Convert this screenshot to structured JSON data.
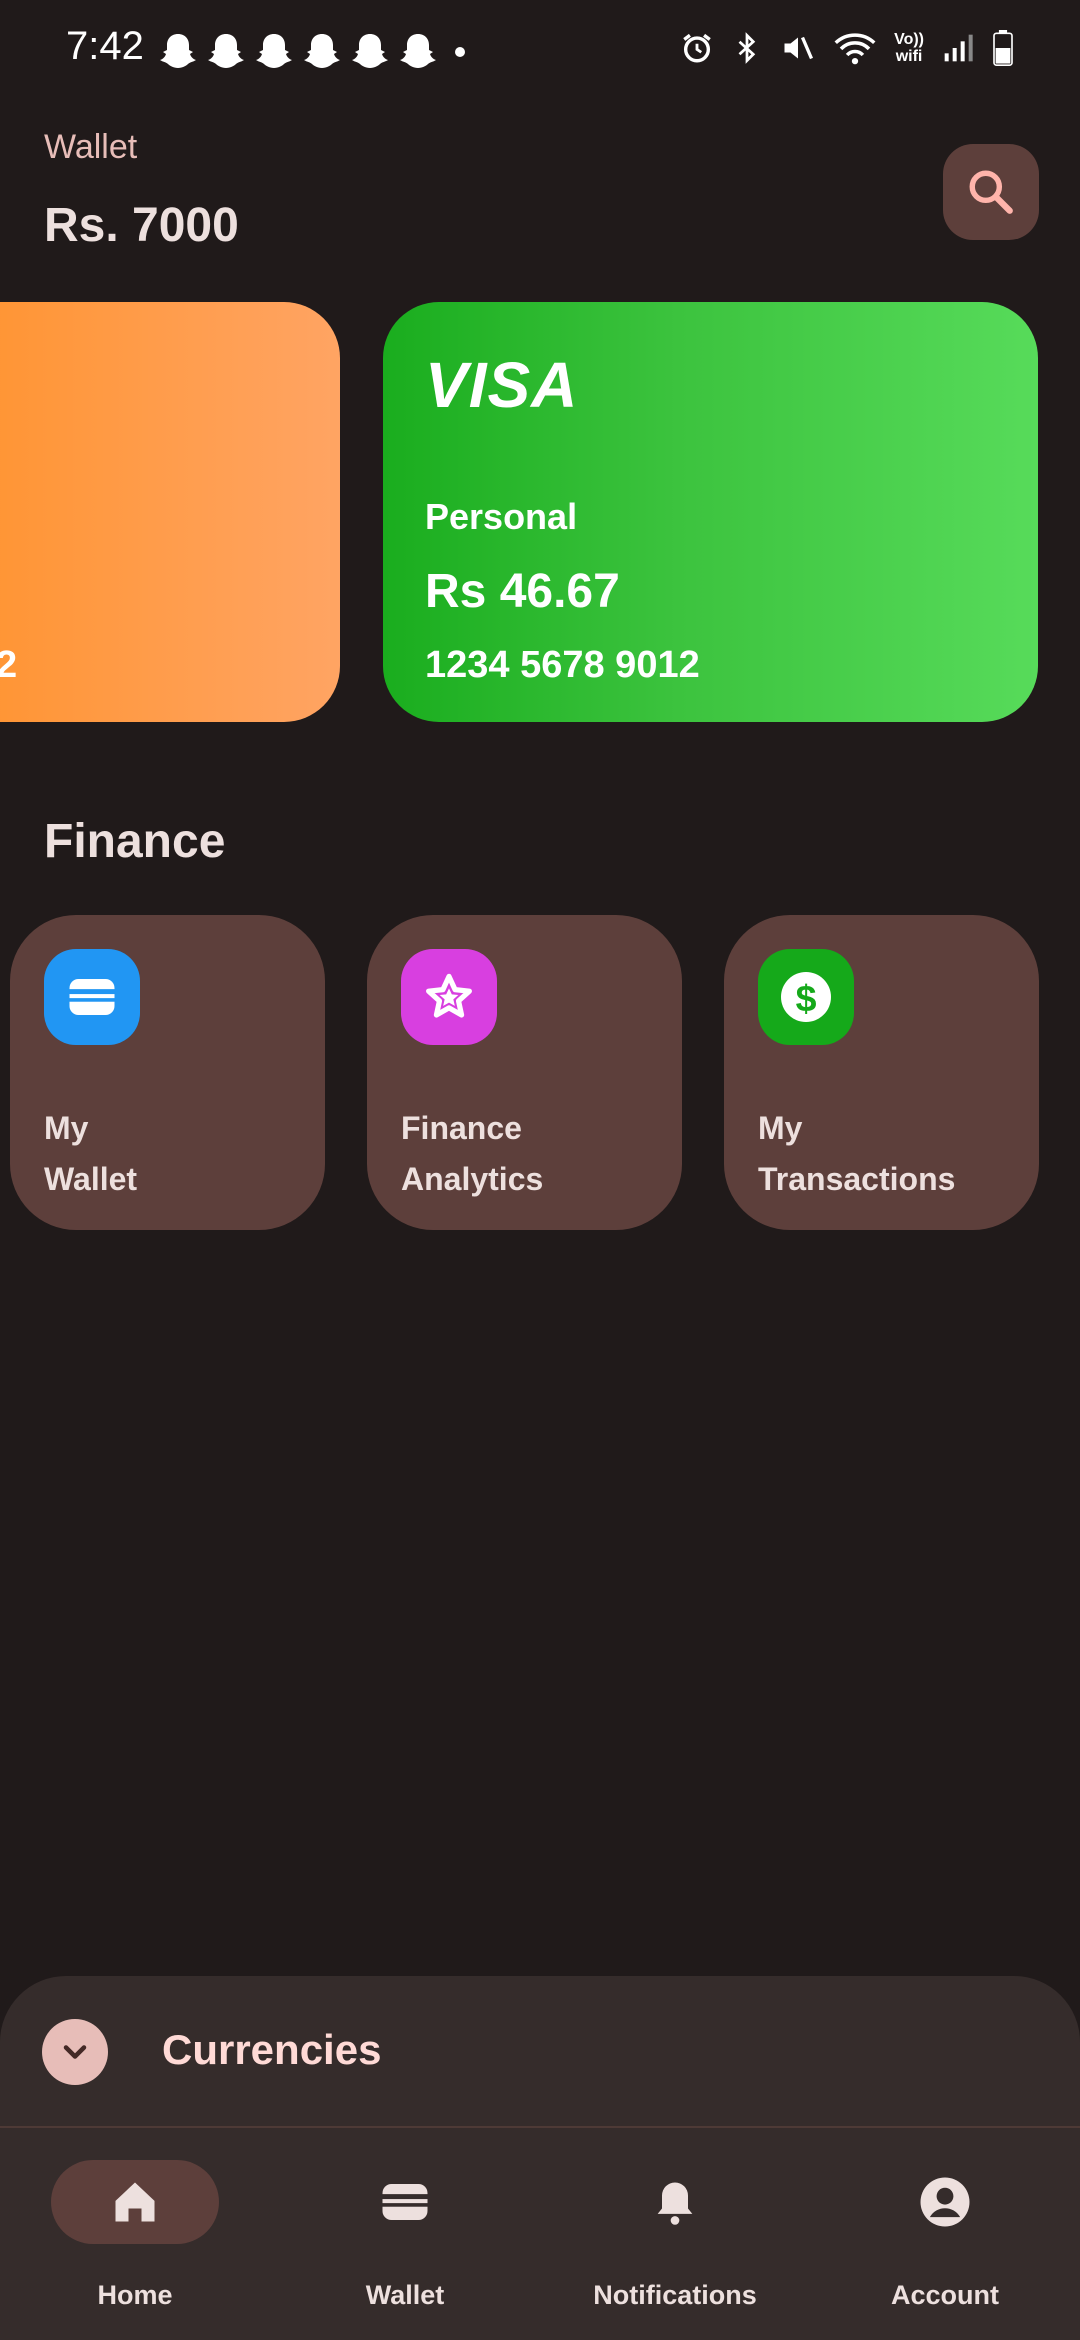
{
  "status_bar": {
    "time": "7:42",
    "notification_icons": [
      "snapchat-icon",
      "snapchat-icon",
      "snapchat-icon",
      "snapchat-icon",
      "snapchat-icon",
      "snapchat-icon"
    ],
    "volte_line1": "Vo))",
    "volte_line2": "wifi"
  },
  "header": {
    "label": "Wallet",
    "total": "Rs. 7000"
  },
  "cards": [
    {
      "color": "#ff922b",
      "number_fragment": "2"
    },
    {
      "brand": "VISA",
      "type": "Personal",
      "balance": "Rs 46.67",
      "number": "1234 5678 9012",
      "color": "#1aad1e"
    }
  ],
  "finance": {
    "title": "Finance",
    "tiles": [
      {
        "label": "My\nWallet",
        "icon": "wallet-icon",
        "icon_color": "#2196f3"
      },
      {
        "label": "Finance\nAnalytics",
        "icon": "star-icon",
        "icon_color": "#d83fe0"
      },
      {
        "label": "My\nTransactions",
        "icon": "dollar-icon",
        "icon_color": "#15a91a"
      }
    ]
  },
  "currencies": {
    "title": "Currencies"
  },
  "nav": {
    "items": [
      {
        "label": "Home",
        "icon": "home-icon",
        "active": true
      },
      {
        "label": "Wallet",
        "icon": "wallet-icon",
        "active": false
      },
      {
        "label": "Notifications",
        "icon": "bell-icon",
        "active": false
      },
      {
        "label": "Account",
        "icon": "account-icon",
        "active": false
      }
    ]
  },
  "colors": {
    "background": "#201a1a",
    "surface": "#352c2b",
    "tile": "#5d3f3b",
    "accent": "#e7bdb8"
  }
}
